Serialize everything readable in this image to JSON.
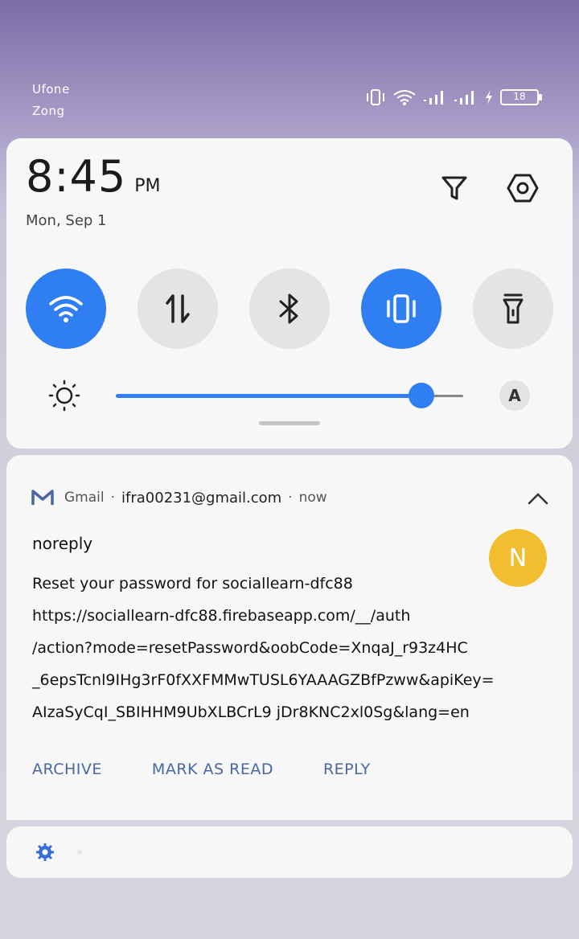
{
  "status_bar": {
    "carrier_1": "Ufone",
    "carrier_2": "Zong",
    "battery_level": "18",
    "icons": [
      "vibrate-icon",
      "wifi-icon",
      "signal-icon",
      "signal-icon",
      "charging-icon",
      "battery-icon"
    ]
  },
  "quick_settings": {
    "time": "8:45",
    "ampm": "PM",
    "date": "Mon, Sep 1",
    "tiles": [
      {
        "name": "wifi",
        "icon": "wifi-icon",
        "state": "on"
      },
      {
        "name": "mobile-data",
        "icon": "data-transfer-icon",
        "state": "off"
      },
      {
        "name": "bluetooth",
        "icon": "bluetooth-icon",
        "state": "off"
      },
      {
        "name": "vibrate",
        "icon": "vibrate-icon",
        "state": "on"
      },
      {
        "name": "flashlight",
        "icon": "flashlight-icon",
        "state": "off"
      }
    ],
    "brightness_level": 0.88,
    "auto_brightness_label": "A",
    "accent_color": "#2f7ff2"
  },
  "notification": {
    "app_name": "Gmail",
    "account": "ifra00231@gmail.com",
    "time": "now",
    "sender": "noreply",
    "avatar_letter": "N",
    "avatar_color": "#f2bd2f",
    "body_lines": [
      "Reset your password for sociallearn-dfc88",
      "https://sociallearn-dfc88.firebaseapp.com/__/auth",
      "/action?mode=resetPassword&oobCode=XnqaJ_r93z4HC",
      "_6epsTcnl9IHg3rF0fXXFMMwTUSL6YAAAGZBfPzww&apiKey=",
      "AIzaSyCqI_SBIHHM9UbXLBCrL9 jDr8KNC2xl0Sg&lang=en"
    ],
    "actions": [
      "ARCHIVE",
      "MARK AS READ",
      "REPLY"
    ]
  }
}
